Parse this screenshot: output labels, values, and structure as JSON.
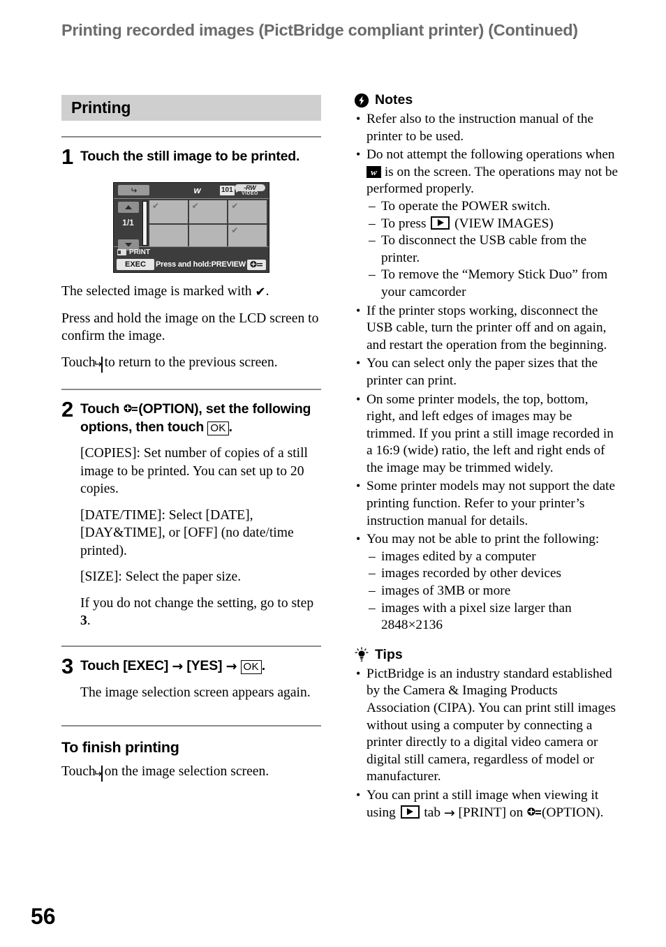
{
  "header": {
    "running_head": "Printing recorded images (PictBridge compliant printer) (Continued)"
  },
  "left_column": {
    "section_title": "Printing",
    "steps": [
      {
        "number": "1",
        "title": "Touch the still image to be printed.",
        "paragraphs": [
          {
            "pre": "The selected image is marked with ",
            "icon": "check-icon",
            "post": "."
          },
          {
            "pre": "Press and hold the image on the LCD screen to confirm the image.",
            "icon": "",
            "post": ""
          },
          {
            "pre": "Touch ",
            "icon": "return-key-icon",
            "post": " to return to the previous screen."
          }
        ]
      },
      {
        "number": "2",
        "title_pre": "Touch ",
        "title_icon": "option-icon",
        "title_mid": "(OPTION), set the following options, then touch ",
        "title_key": "OK",
        "title_post": ".",
        "paragraphs": [
          "[COPIES]: Set number of copies of a still image to be printed. You can set up to 20 copies.",
          "[DATE/TIME]: Select [DATE], [DAY&TIME], or [OFF] (no date/time printed).",
          "[SIZE]: Select the paper size.",
          "If you do not change the setting, go to step "
        ],
        "step_ref": "3",
        "step_ref_post": "."
      },
      {
        "number": "3",
        "title_pre": "Touch [EXEC] ",
        "arrow1": "→",
        "title_mid": " [YES] ",
        "arrow2": "→",
        "title_key": "OK",
        "title_post": ".",
        "paragraphs": [
          "The image selection screen appears again."
        ]
      }
    ],
    "finish": {
      "heading": "To finish printing",
      "pre": "Touch ",
      "icon": "return-key-icon",
      "post": " on the image selection screen."
    }
  },
  "lcd_screen": {
    "back_button": "return-arrow",
    "pictbridge_icon": "pictbridge-icon",
    "folder_number": "101",
    "disc_label_top": "-RW",
    "disc_label_bottom": "VIDEO",
    "page_indicator": "1/1",
    "up_arrow": "scroll-up",
    "down_arrow": "scroll-down",
    "cells_checked": [
      true,
      true,
      true,
      false,
      false,
      true
    ],
    "print_label": "PRINT",
    "exec_button": "EXEC",
    "hold_hint": "Press and hold:PREVIEW",
    "option_button": "option-icon"
  },
  "right_column": {
    "notes": {
      "icon": "notes-icon",
      "heading": "Notes",
      "items": [
        {
          "type": "text",
          "text": "Refer also to the instruction manual of the printer to be used."
        },
        {
          "type": "icon_inline",
          "pre": "Do not attempt the following operations when ",
          "icon": "pictbridge-icon",
          "post": " is on the screen. The operations may not be performed properly."
        }
      ],
      "sub_items_1": [
        {
          "type": "text",
          "text": "To operate the POWER switch."
        },
        {
          "type": "icon_inline",
          "pre": "To press ",
          "icon": "view-images-icon",
          "post": " (VIEW IMAGES)"
        },
        {
          "type": "text",
          "text": "To disconnect the USB cable from the printer."
        },
        {
          "type": "text",
          "text": "To remove the “Memory Stick Duo” from your camcorder"
        }
      ],
      "items_2": [
        "If the printer stops working, disconnect the USB cable, turn the printer off and on again, and restart the operation from the beginning.",
        "You can select only the paper sizes that the printer can print.",
        "On some printer models, the top, bottom, right, and left edges of images may be trimmed. If you print a still image recorded in a 16:9 (wide) ratio, the left and right ends of the image may be trimmed widely.",
        "Some printer models may not support the date printing function. Refer to your printer’s instruction manual for details.",
        "You may not be able to print the following:"
      ],
      "sub_items_2": [
        "images edited by a computer",
        "images recorded by other devices",
        "images of 3MB or more",
        "images with a pixel size larger than 2848×2136"
      ]
    },
    "tips": {
      "icon": "tips-icon",
      "heading": "Tips",
      "items": [
        {
          "type": "text",
          "text": "PictBridge is an industry standard established by the Camera & Imaging Products Association (CIPA). You can print still images without using a computer by connecting a printer directly to a digital video camera or digital still camera, regardless of model or manufacturer."
        },
        {
          "type": "rich",
          "pre": "You can print a still image when viewing it using ",
          "icon1": "view-images-icon",
          "mid": " tab ",
          "arrow": "→",
          "mid2": " [PRINT] on ",
          "icon2": "option-icon",
          "post": "(OPTION)."
        }
      ]
    }
  },
  "footer": {
    "page_number": "56"
  }
}
